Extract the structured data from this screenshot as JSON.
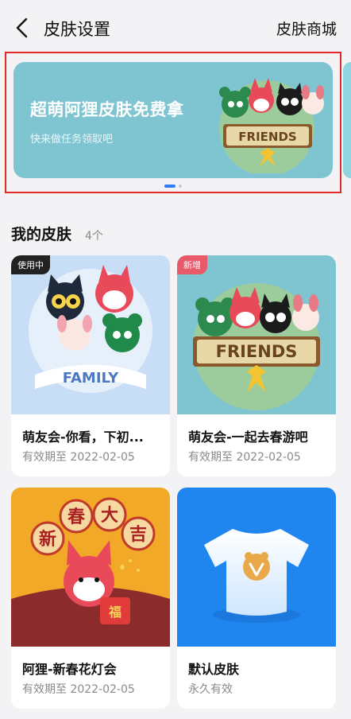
{
  "header": {
    "title": "皮肤设置",
    "store_label": "皮肤商城"
  },
  "banner": {
    "title": "超萌阿狸皮肤免费拿",
    "subtitle": "快来做任务领取吧",
    "art_text": "FRIENDS",
    "page_index": 1,
    "page_total": 2
  },
  "section": {
    "title": "我的皮肤",
    "count": "4个"
  },
  "skins": [
    {
      "name": "萌友会-你看，下初...",
      "expiry": "有效期至 2022-02-05",
      "badge": "使用中",
      "art_text": "FAMILY"
    },
    {
      "name": "萌友会-一起去春游吧",
      "expiry": "有效期至 2022-02-05",
      "badge": "新增",
      "art_text": "FRIENDS"
    },
    {
      "name": "阿狸-新春花灯会",
      "expiry": "有效期至 2022-02-05",
      "art_chars": [
        "新",
        "春",
        "大",
        "吉"
      ],
      "art_small": "福"
    },
    {
      "name": "默认皮肤",
      "expiry": "永久有效"
    }
  ],
  "colors": {
    "accent": "#2f7cf6",
    "banner_bg": "#7ec5d1",
    "badge_using": "#222222",
    "badge_new": "#e85a6a",
    "highlight_frame": "#e02a2a"
  }
}
